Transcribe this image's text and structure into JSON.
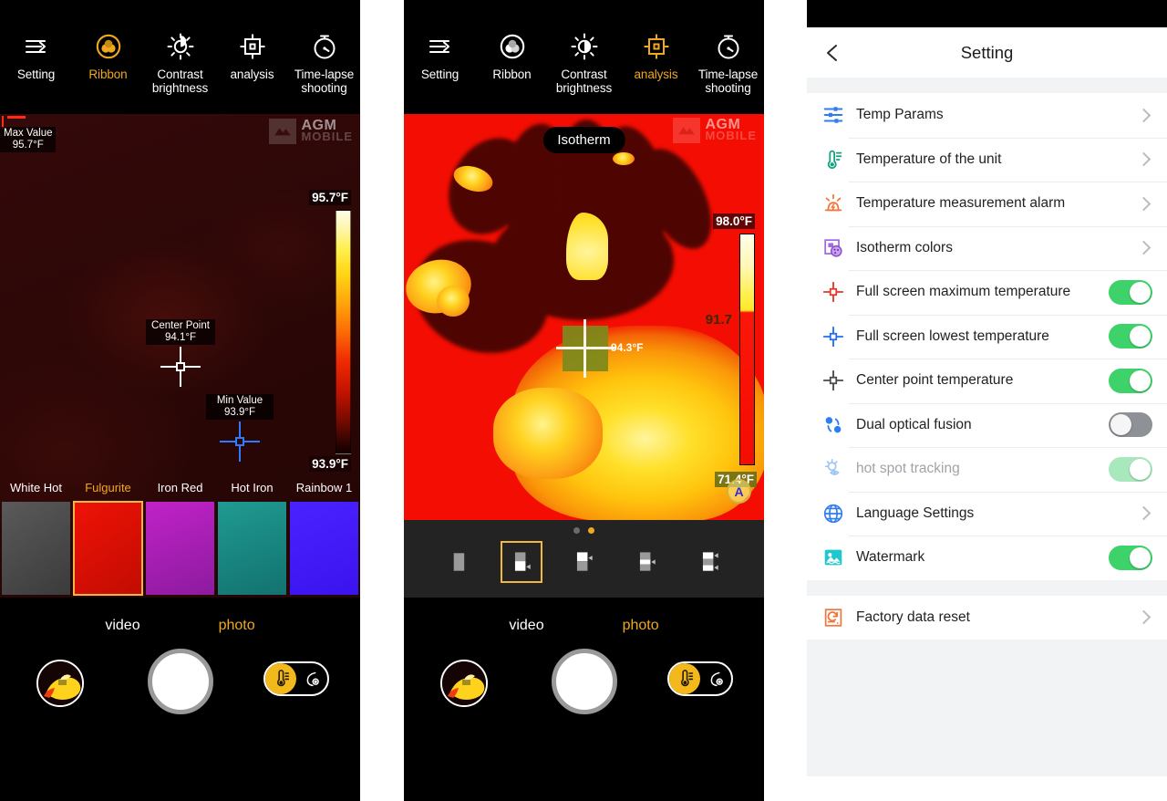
{
  "panel1": {
    "toolbar": [
      {
        "label": "Setting",
        "icon": "settings-list-icon",
        "active": false
      },
      {
        "label": "Ribbon",
        "icon": "ribbon-palette-icon",
        "active": true
      },
      {
        "label": "Contrast brightness",
        "icon": "brightness-icon",
        "active": false
      },
      {
        "label": "analysis",
        "icon": "analysis-target-icon",
        "active": false
      },
      {
        "label": "Time-lapse shooting",
        "icon": "timelapse-stopwatch-icon",
        "active": false
      }
    ],
    "watermark": {
      "line1": "AGM",
      "line2": "MOBILE"
    },
    "max_marker": {
      "title": "Max Value",
      "value": "95.7°F"
    },
    "center_marker": {
      "title": "Center Point",
      "value": "94.1°F"
    },
    "min_marker": {
      "title": "Min Value",
      "value": "93.9°F"
    },
    "colorbar": {
      "top": "95.7°F",
      "bottom": "93.9°F"
    },
    "palettes": [
      {
        "name": "White Hot",
        "color": "#4a4a4a",
        "selected": false
      },
      {
        "name": "Fulgurite",
        "color": "#e01005",
        "selected": true
      },
      {
        "name": "Iron Red",
        "color": "#ad21b4",
        "selected": false
      },
      {
        "name": "Hot Iron",
        "color": "#1d8a85",
        "selected": false
      },
      {
        "name": "Rainbow 1",
        "color": "#4220f5",
        "selected": false
      }
    ],
    "modes": [
      {
        "label": "video",
        "active": false
      },
      {
        "label": "photo",
        "active": true
      }
    ],
    "gallery_icon": "thermal-thumbnail-icon",
    "shutter": "shutter-button",
    "toggle": {
      "left_icon": "thermometer-icon",
      "right_icon": "night-mode-icon"
    }
  },
  "panel2": {
    "toolbar": [
      {
        "label": "Setting",
        "icon": "settings-list-icon",
        "active": false
      },
      {
        "label": "Ribbon",
        "icon": "ribbon-palette-icon",
        "active": false
      },
      {
        "label": "Contrast brightness",
        "icon": "brightness-icon",
        "active": false
      },
      {
        "label": "analysis",
        "icon": "analysis-target-icon",
        "active": true
      },
      {
        "label": "Time-lapse shooting",
        "icon": "timelapse-stopwatch-icon",
        "active": false
      }
    ],
    "isotherm_pill": "Isotherm",
    "watermark": {
      "line1": "AGM",
      "line2": "MOBILE"
    },
    "colorbar": {
      "top": "98.0°F",
      "mid": "91.7",
      "bottom": "71.4°F"
    },
    "region_box_value": "94.3°F",
    "auto_badge": "A",
    "page_dots": [
      false,
      true
    ],
    "tools": [
      {
        "name": "region-tool-1",
        "selected": false
      },
      {
        "name": "region-tool-2",
        "selected": true
      },
      {
        "name": "region-tool-3",
        "selected": false
      },
      {
        "name": "region-tool-4",
        "selected": false
      },
      {
        "name": "region-tool-5",
        "selected": false
      }
    ],
    "modes": [
      {
        "label": "video",
        "active": false
      },
      {
        "label": "photo",
        "active": true
      }
    ],
    "gallery_icon": "thermal-thumbnail-icon",
    "shutter": "shutter-button",
    "toggle": {
      "left_icon": "thermometer-icon",
      "right_icon": "night-mode-icon"
    }
  },
  "panel3": {
    "title": "Setting",
    "back_icon": "chevron-left-icon",
    "group1": [
      {
        "label": "Temp Params",
        "icon": "sliders-icon",
        "icon_color": "#2f7ef0",
        "control": "chevron"
      },
      {
        "label": "Temperature of the unit",
        "icon": "thermometer-unit-icon",
        "icon_color": "#13a37f",
        "control": "chevron"
      },
      {
        "label": "Temperature measurement alarm",
        "icon": "alarm-temp-icon",
        "icon_color": "#f4743b",
        "control": "chevron"
      },
      {
        "label": "Isotherm colors",
        "icon": "isotherm-colors-icon",
        "icon_color": "#a06cdb",
        "control": "chevron"
      },
      {
        "label": "Full screen maximum temperature",
        "icon": "max-crosshair-icon",
        "icon_color": "#e8342a",
        "control": "switch",
        "state": "on"
      },
      {
        "label": "Full screen lowest temperature",
        "icon": "min-crosshair-icon",
        "icon_color": "#1f6ff0",
        "control": "switch",
        "state": "on"
      },
      {
        "label": "Center point temperature",
        "icon": "center-crosshair-icon",
        "icon_color": "#4a4a4a",
        "control": "switch",
        "state": "on"
      },
      {
        "label": "Dual optical fusion",
        "icon": "dual-fusion-icon",
        "icon_color": "#2f7ef0",
        "control": "switch",
        "state": "off"
      },
      {
        "label": "hot spot tracking",
        "icon": "hotspot-tracking-icon",
        "icon_color": "#9ec6f2",
        "control": "switch",
        "state": "dim",
        "disabled": true
      },
      {
        "label": "Language Settings",
        "icon": "globe-icon",
        "icon_color": "#2f7ef0",
        "control": "chevron"
      },
      {
        "label": "Watermark",
        "icon": "watermark-image-icon",
        "icon_color": "#21c7cf",
        "control": "switch",
        "state": "on"
      }
    ],
    "group2": [
      {
        "label": "Factory data reset",
        "icon": "factory-reset-icon",
        "icon_color": "#f4743b",
        "control": "chevron"
      }
    ]
  },
  "colors": {
    "accent": "#f0a81e",
    "switch_on": "#3ed36a",
    "switch_off": "#8e9196",
    "thermal_red": "#f40d02"
  }
}
